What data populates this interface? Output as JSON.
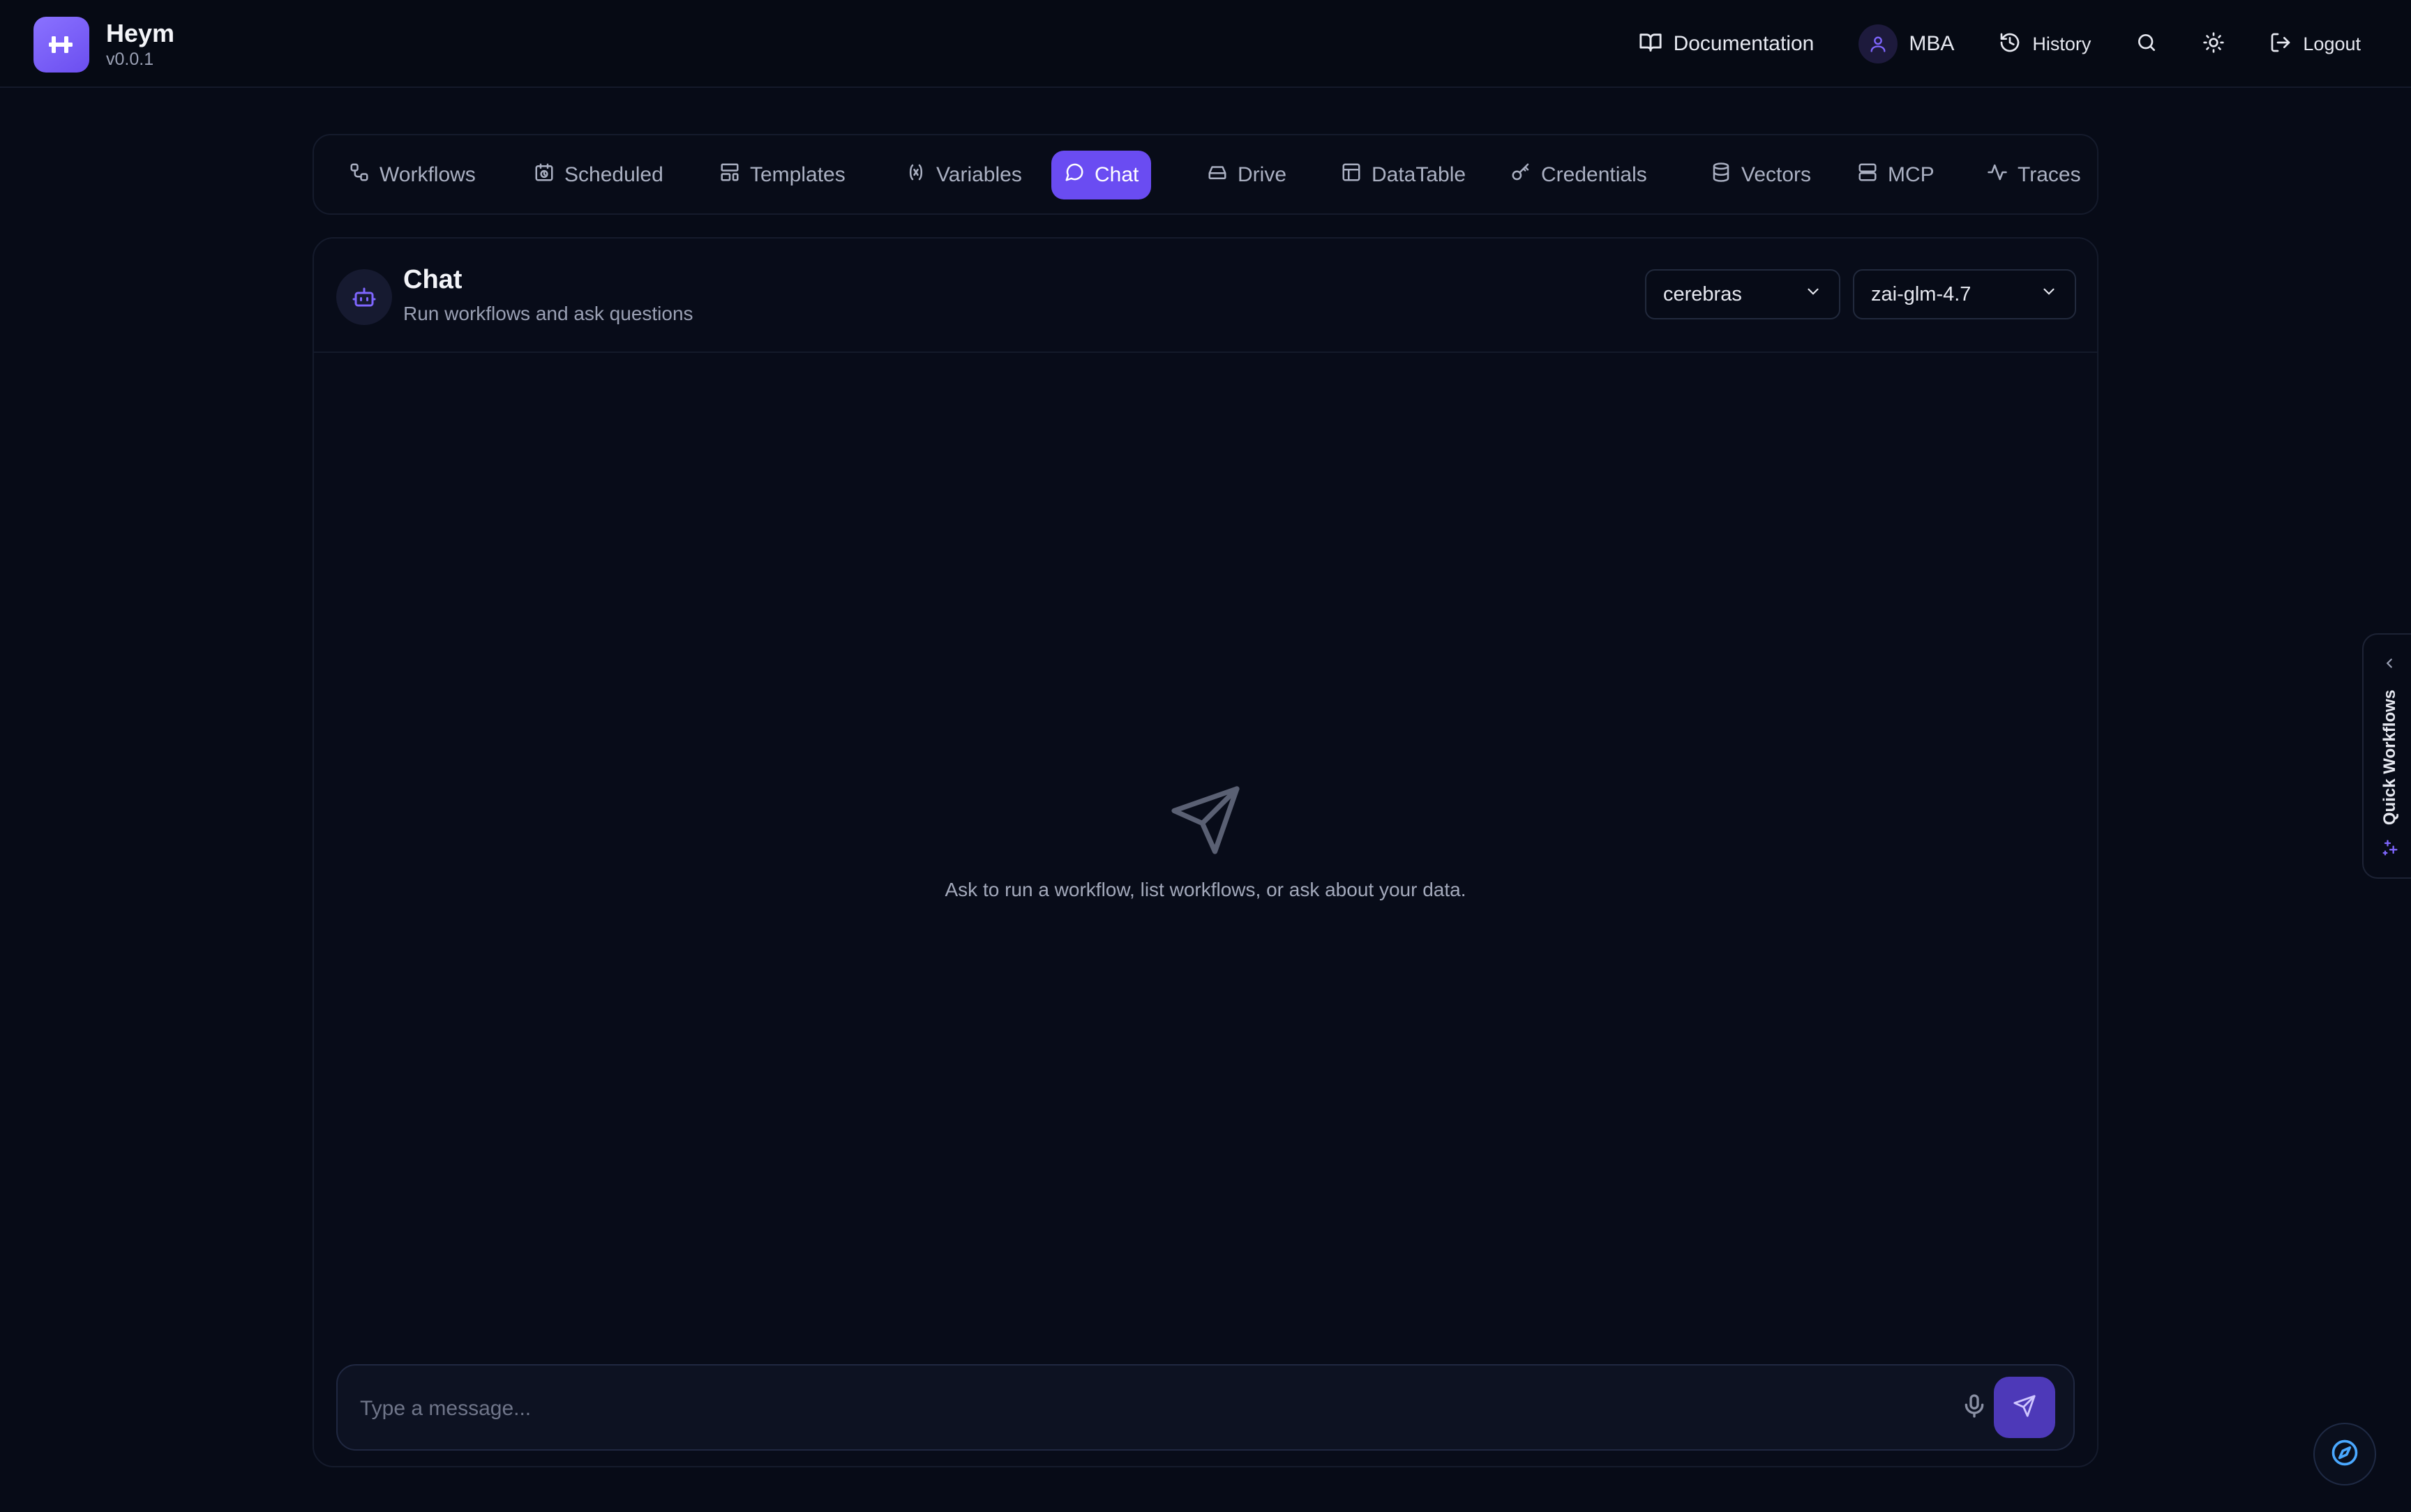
{
  "app": {
    "name": "Heym",
    "version": "v0.0.1"
  },
  "topnav": {
    "documentation": "Documentation",
    "user": "MBA",
    "history": "History",
    "logout": "Logout"
  },
  "tabs": [
    {
      "label": "Workflows",
      "icon": "workflow-icon"
    },
    {
      "label": "Scheduled",
      "icon": "calendar-clock-icon"
    },
    {
      "label": "Templates",
      "icon": "layout-template-icon"
    },
    {
      "label": "Variables",
      "icon": "variable-icon"
    },
    {
      "label": "Chat",
      "icon": "message-circle-icon",
      "active": true
    },
    {
      "label": "Drive",
      "icon": "hard-drive-icon"
    },
    {
      "label": "DataTable",
      "icon": "table-icon"
    },
    {
      "label": "Credentials",
      "icon": "key-icon"
    },
    {
      "label": "Vectors",
      "icon": "database-icon"
    },
    {
      "label": "MCP",
      "icon": "server-icon"
    },
    {
      "label": "Traces",
      "icon": "activity-icon"
    }
  ],
  "chat": {
    "title": "Chat",
    "subtitle": "Run workflows and ask questions",
    "provider": "cerebras",
    "model": "zai-glm-4.7",
    "empty_text": "Ask to run a workflow, list workflows, or ask about your data.",
    "input_placeholder": "Type a message..."
  },
  "side_panel": {
    "label": "Quick Workflows"
  },
  "colors": {
    "background": "#070b17",
    "accent": "#6a4cf2",
    "text": "#e6e8f0",
    "muted": "#9aa0b4"
  }
}
